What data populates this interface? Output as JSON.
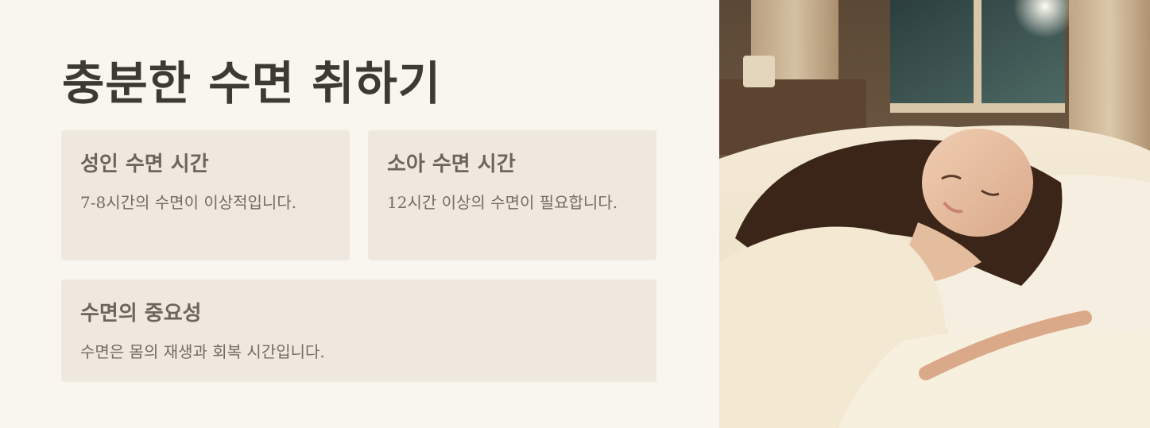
{
  "title": "충분한 수면 취하기",
  "cards": [
    {
      "title": "성인 수면 시간",
      "body": "7-8시간의 수면이 이상적입니다."
    },
    {
      "title": "소아 수면 시간",
      "body": "12시간 이상의 수면이 필요합니다."
    },
    {
      "title": "수면의 중요성",
      "body": "수면은 몸의 재생과 회복 시간입니다."
    }
  ],
  "image": {
    "subject": "sleeping-woman-photo"
  }
}
